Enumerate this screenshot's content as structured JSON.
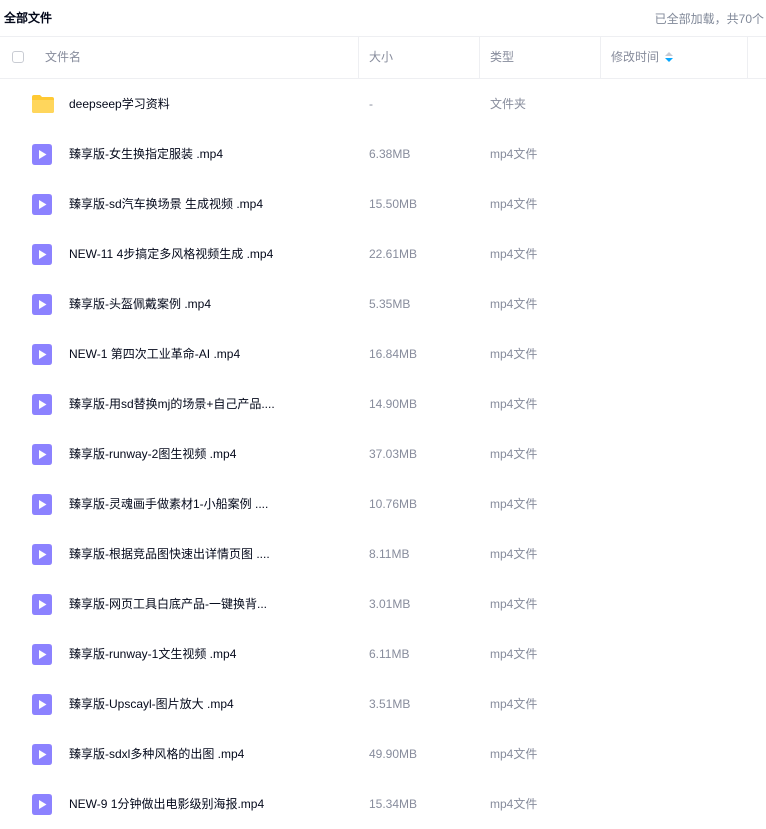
{
  "topbar": {
    "title": "全部文件",
    "status": "已全部加载，共70个"
  },
  "table": {
    "columns": {
      "name": "文件名",
      "size": "大小",
      "type": "类型",
      "modified": "修改时间"
    },
    "rows": [
      {
        "icon": "folder-icon",
        "name": "deepseep学习资料",
        "size": "-",
        "type": "文件夹"
      },
      {
        "icon": "video-file-icon",
        "name": "臻享版-女生换指定服装 .mp4",
        "size": "6.38MB",
        "type": "mp4文件"
      },
      {
        "icon": "video-file-icon",
        "name": "臻享版-sd汽车换场景 生成视频 .mp4",
        "size": "15.50MB",
        "type": "mp4文件"
      },
      {
        "icon": "video-file-icon",
        "name": "NEW-11 4步搞定多风格视频生成 .mp4",
        "size": "22.61MB",
        "type": "mp4文件"
      },
      {
        "icon": "video-file-icon",
        "name": "臻享版-头盔佩戴案例 .mp4",
        "size": "5.35MB",
        "type": "mp4文件"
      },
      {
        "icon": "video-file-icon",
        "name": "NEW-1 第四次工业革命-AI .mp4",
        "size": "16.84MB",
        "type": "mp4文件"
      },
      {
        "icon": "video-file-icon",
        "name": "臻享版-用sd替换mj的场景+自己产品....",
        "size": "14.90MB",
        "type": "mp4文件"
      },
      {
        "icon": "video-file-icon",
        "name": "臻享版-runway-2图生视频 .mp4",
        "size": "37.03MB",
        "type": "mp4文件"
      },
      {
        "icon": "video-file-icon",
        "name": "臻享版-灵魂画手做素材1-小船案例 ....",
        "size": "10.76MB",
        "type": "mp4文件"
      },
      {
        "icon": "video-file-icon",
        "name": "臻享版-根据竞品图快速出详情页图 ....",
        "size": "8.11MB",
        "type": "mp4文件"
      },
      {
        "icon": "video-file-icon",
        "name": "臻享版-网页工具白底产品-一键换背...",
        "size": "3.01MB",
        "type": "mp4文件"
      },
      {
        "icon": "video-file-icon",
        "name": "臻享版-runway-1文生视频 .mp4",
        "size": "6.11MB",
        "type": "mp4文件"
      },
      {
        "icon": "video-file-icon",
        "name": "臻享版-Upscayl-图片放大 .mp4",
        "size": "3.51MB",
        "type": "mp4文件"
      },
      {
        "icon": "video-file-icon",
        "name": "臻享版-sdxl多种风格的出图 .mp4",
        "size": "49.90MB",
        "type": "mp4文件"
      },
      {
        "icon": "video-file-icon",
        "name": "NEW-9 1分钟做出电影级别海报.mp4",
        "size": "15.34MB",
        "type": "mp4文件"
      }
    ]
  },
  "colors": {
    "folder": "#ffc933",
    "video": "#8c82ff",
    "accent": "#06a7ff"
  }
}
